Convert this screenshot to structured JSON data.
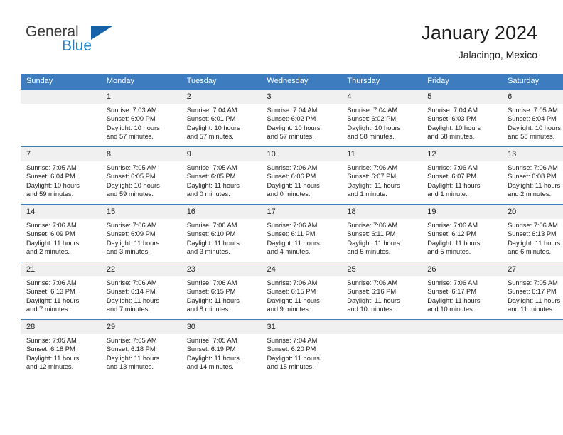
{
  "logo": {
    "word1": "General",
    "word2": "Blue",
    "triangle_color": "#1462a8",
    "blue_color": "#1f7fc4"
  },
  "header": {
    "title": "January 2024",
    "subtitle": "Jalacingo, Mexico"
  },
  "theme": {
    "header_band": "#3c7cbf",
    "daynum_band": "#f0f0f0",
    "text": "#1a1a1a"
  },
  "weekday_headers": [
    "Sunday",
    "Monday",
    "Tuesday",
    "Wednesday",
    "Thursday",
    "Friday",
    "Saturday"
  ],
  "weeks": [
    [
      {
        "day": "",
        "sunrise": "",
        "sunset": "",
        "daylight1": "",
        "daylight2": ""
      },
      {
        "day": "1",
        "sunrise": "Sunrise: 7:03 AM",
        "sunset": "Sunset: 6:00 PM",
        "daylight1": "Daylight: 10 hours",
        "daylight2": "and 57 minutes."
      },
      {
        "day": "2",
        "sunrise": "Sunrise: 7:04 AM",
        "sunset": "Sunset: 6:01 PM",
        "daylight1": "Daylight: 10 hours",
        "daylight2": "and 57 minutes."
      },
      {
        "day": "3",
        "sunrise": "Sunrise: 7:04 AM",
        "sunset": "Sunset: 6:02 PM",
        "daylight1": "Daylight: 10 hours",
        "daylight2": "and 57 minutes."
      },
      {
        "day": "4",
        "sunrise": "Sunrise: 7:04 AM",
        "sunset": "Sunset: 6:02 PM",
        "daylight1": "Daylight: 10 hours",
        "daylight2": "and 58 minutes."
      },
      {
        "day": "5",
        "sunrise": "Sunrise: 7:04 AM",
        "sunset": "Sunset: 6:03 PM",
        "daylight1": "Daylight: 10 hours",
        "daylight2": "and 58 minutes."
      },
      {
        "day": "6",
        "sunrise": "Sunrise: 7:05 AM",
        "sunset": "Sunset: 6:04 PM",
        "daylight1": "Daylight: 10 hours",
        "daylight2": "and 58 minutes."
      }
    ],
    [
      {
        "day": "7",
        "sunrise": "Sunrise: 7:05 AM",
        "sunset": "Sunset: 6:04 PM",
        "daylight1": "Daylight: 10 hours",
        "daylight2": "and 59 minutes."
      },
      {
        "day": "8",
        "sunrise": "Sunrise: 7:05 AM",
        "sunset": "Sunset: 6:05 PM",
        "daylight1": "Daylight: 10 hours",
        "daylight2": "and 59 minutes."
      },
      {
        "day": "9",
        "sunrise": "Sunrise: 7:05 AM",
        "sunset": "Sunset: 6:05 PM",
        "daylight1": "Daylight: 11 hours",
        "daylight2": "and 0 minutes."
      },
      {
        "day": "10",
        "sunrise": "Sunrise: 7:06 AM",
        "sunset": "Sunset: 6:06 PM",
        "daylight1": "Daylight: 11 hours",
        "daylight2": "and 0 minutes."
      },
      {
        "day": "11",
        "sunrise": "Sunrise: 7:06 AM",
        "sunset": "Sunset: 6:07 PM",
        "daylight1": "Daylight: 11 hours",
        "daylight2": "and 1 minute."
      },
      {
        "day": "12",
        "sunrise": "Sunrise: 7:06 AM",
        "sunset": "Sunset: 6:07 PM",
        "daylight1": "Daylight: 11 hours",
        "daylight2": "and 1 minute."
      },
      {
        "day": "13",
        "sunrise": "Sunrise: 7:06 AM",
        "sunset": "Sunset: 6:08 PM",
        "daylight1": "Daylight: 11 hours",
        "daylight2": "and 2 minutes."
      }
    ],
    [
      {
        "day": "14",
        "sunrise": "Sunrise: 7:06 AM",
        "sunset": "Sunset: 6:09 PM",
        "daylight1": "Daylight: 11 hours",
        "daylight2": "and 2 minutes."
      },
      {
        "day": "15",
        "sunrise": "Sunrise: 7:06 AM",
        "sunset": "Sunset: 6:09 PM",
        "daylight1": "Daylight: 11 hours",
        "daylight2": "and 3 minutes."
      },
      {
        "day": "16",
        "sunrise": "Sunrise: 7:06 AM",
        "sunset": "Sunset: 6:10 PM",
        "daylight1": "Daylight: 11 hours",
        "daylight2": "and 3 minutes."
      },
      {
        "day": "17",
        "sunrise": "Sunrise: 7:06 AM",
        "sunset": "Sunset: 6:11 PM",
        "daylight1": "Daylight: 11 hours",
        "daylight2": "and 4 minutes."
      },
      {
        "day": "18",
        "sunrise": "Sunrise: 7:06 AM",
        "sunset": "Sunset: 6:11 PM",
        "daylight1": "Daylight: 11 hours",
        "daylight2": "and 5 minutes."
      },
      {
        "day": "19",
        "sunrise": "Sunrise: 7:06 AM",
        "sunset": "Sunset: 6:12 PM",
        "daylight1": "Daylight: 11 hours",
        "daylight2": "and 5 minutes."
      },
      {
        "day": "20",
        "sunrise": "Sunrise: 7:06 AM",
        "sunset": "Sunset: 6:13 PM",
        "daylight1": "Daylight: 11 hours",
        "daylight2": "and 6 minutes."
      }
    ],
    [
      {
        "day": "21",
        "sunrise": "Sunrise: 7:06 AM",
        "sunset": "Sunset: 6:13 PM",
        "daylight1": "Daylight: 11 hours",
        "daylight2": "and 7 minutes."
      },
      {
        "day": "22",
        "sunrise": "Sunrise: 7:06 AM",
        "sunset": "Sunset: 6:14 PM",
        "daylight1": "Daylight: 11 hours",
        "daylight2": "and 7 minutes."
      },
      {
        "day": "23",
        "sunrise": "Sunrise: 7:06 AM",
        "sunset": "Sunset: 6:15 PM",
        "daylight1": "Daylight: 11 hours",
        "daylight2": "and 8 minutes."
      },
      {
        "day": "24",
        "sunrise": "Sunrise: 7:06 AM",
        "sunset": "Sunset: 6:15 PM",
        "daylight1": "Daylight: 11 hours",
        "daylight2": "and 9 minutes."
      },
      {
        "day": "25",
        "sunrise": "Sunrise: 7:06 AM",
        "sunset": "Sunset: 6:16 PM",
        "daylight1": "Daylight: 11 hours",
        "daylight2": "and 10 minutes."
      },
      {
        "day": "26",
        "sunrise": "Sunrise: 7:06 AM",
        "sunset": "Sunset: 6:17 PM",
        "daylight1": "Daylight: 11 hours",
        "daylight2": "and 10 minutes."
      },
      {
        "day": "27",
        "sunrise": "Sunrise: 7:05 AM",
        "sunset": "Sunset: 6:17 PM",
        "daylight1": "Daylight: 11 hours",
        "daylight2": "and 11 minutes."
      }
    ],
    [
      {
        "day": "28",
        "sunrise": "Sunrise: 7:05 AM",
        "sunset": "Sunset: 6:18 PM",
        "daylight1": "Daylight: 11 hours",
        "daylight2": "and 12 minutes."
      },
      {
        "day": "29",
        "sunrise": "Sunrise: 7:05 AM",
        "sunset": "Sunset: 6:18 PM",
        "daylight1": "Daylight: 11 hours",
        "daylight2": "and 13 minutes."
      },
      {
        "day": "30",
        "sunrise": "Sunrise: 7:05 AM",
        "sunset": "Sunset: 6:19 PM",
        "daylight1": "Daylight: 11 hours",
        "daylight2": "and 14 minutes."
      },
      {
        "day": "31",
        "sunrise": "Sunrise: 7:04 AM",
        "sunset": "Sunset: 6:20 PM",
        "daylight1": "Daylight: 11 hours",
        "daylight2": "and 15 minutes."
      },
      {
        "day": "",
        "sunrise": "",
        "sunset": "",
        "daylight1": "",
        "daylight2": ""
      },
      {
        "day": "",
        "sunrise": "",
        "sunset": "",
        "daylight1": "",
        "daylight2": ""
      },
      {
        "day": "",
        "sunrise": "",
        "sunset": "",
        "daylight1": "",
        "daylight2": ""
      }
    ]
  ]
}
